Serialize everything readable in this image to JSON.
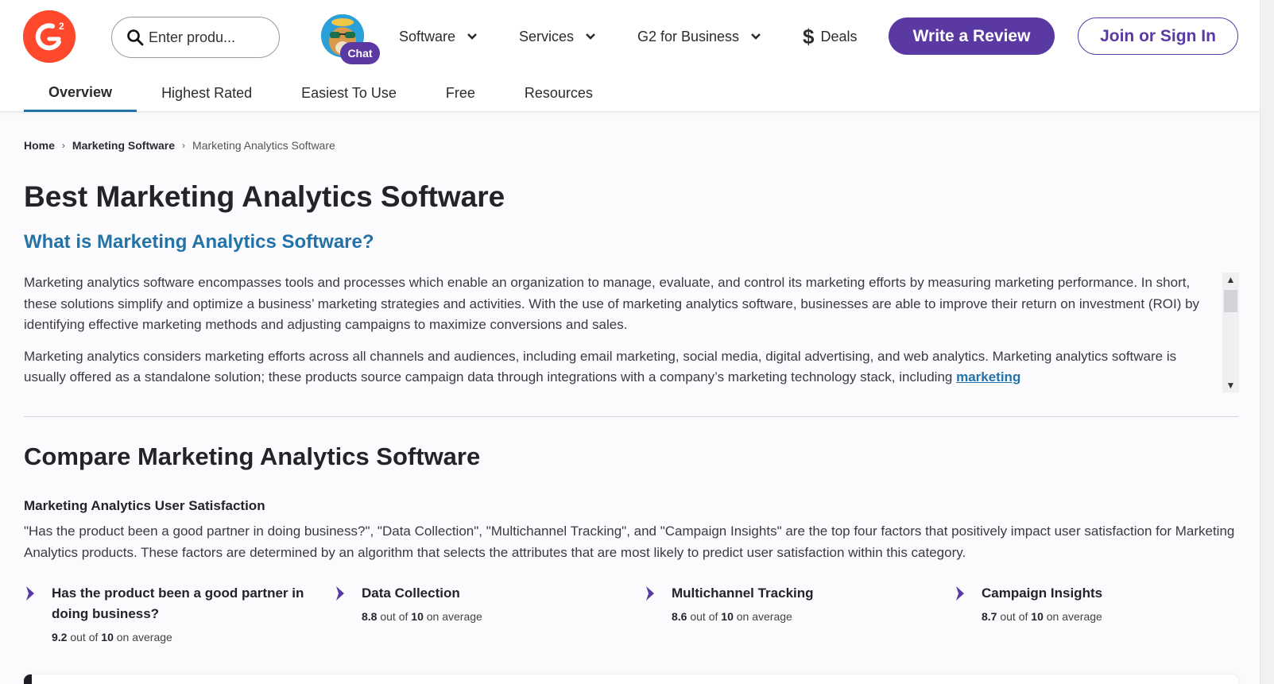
{
  "header": {
    "logo_text": "G2",
    "search": {
      "placeholder": "Enter produ..."
    },
    "chat_label": "Chat",
    "nav": [
      {
        "label": "Software"
      },
      {
        "label": "Services"
      },
      {
        "label": "G2 for Business"
      },
      {
        "label": "Deals"
      }
    ],
    "write_review_label": "Write a Review",
    "join_label": "Join or Sign In"
  },
  "tabs": [
    {
      "label": "Overview",
      "active": true
    },
    {
      "label": "Highest Rated",
      "active": false
    },
    {
      "label": "Easiest To Use",
      "active": false
    },
    {
      "label": "Free",
      "active": false
    },
    {
      "label": "Resources",
      "active": false
    }
  ],
  "breadcrumb": {
    "items": [
      "Home",
      "Marketing Software"
    ],
    "current": "Marketing Analytics Software"
  },
  "page_title": "Best Marketing Analytics Software",
  "what_is": {
    "heading": "What is Marketing Analytics Software?",
    "para1": "Marketing analytics software encompasses tools and processes which enable an organization to manage, evaluate, and control its marketing efforts by measuring marketing performance. In short, these solutions simplify and optimize a business’ marketing strategies and activities. With the use of marketing analytics software, businesses are able to improve their return on investment (ROI) by identifying effective marketing methods and adjusting campaigns to maximize conversions and sales.",
    "para2": "Marketing analytics considers marketing efforts across all channels and audiences, including email marketing, social media, digital advertising, and web analytics. Marketing analytics software is usually offered as a standalone solution; these products source campaign data through integrations with a company’s marketing technology stack, including ",
    "para2_link": "marketing"
  },
  "compare": {
    "heading": "Compare Marketing Analytics Software",
    "satisfaction_title": "Marketing Analytics User Satisfaction",
    "satisfaction_desc": "\"Has the product been a good partner in doing business?\", \"Data Collection\", \"Multichannel Tracking\", and \"Campaign Insights\" are the top four factors that positively impact user satisfaction for Marketing Analytics products. These factors are determined by an algorithm that selects the attributes that are most likely to predict user satisfaction within this category.",
    "factors": [
      {
        "name": "Has the product been a good partner in doing business?",
        "score": "9.2",
        "out_of_text": "out of",
        "max": "10",
        "suffix": "on average"
      },
      {
        "name": "Data Collection",
        "score": "8.8",
        "out_of_text": "out of",
        "max": "10",
        "suffix": "on average"
      },
      {
        "name": "Multichannel Tracking",
        "score": "8.6",
        "out_of_text": "out of",
        "max": "10",
        "suffix": "on average"
      },
      {
        "name": "Campaign Insights",
        "score": "8.7",
        "out_of_text": "out of",
        "max": "10",
        "suffix": "on average"
      }
    ]
  },
  "colors": {
    "brand_red": "#ff492c",
    "brand_purple": "#5a39a2",
    "link_blue": "#2372a8"
  }
}
